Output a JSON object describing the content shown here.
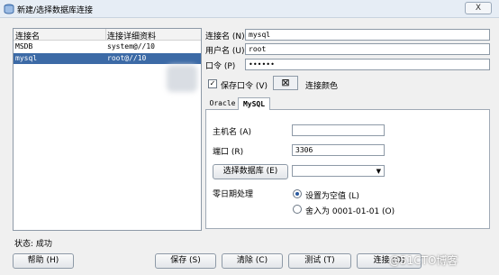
{
  "window": {
    "title": "新建/选择数据库连接",
    "close_label": "X"
  },
  "connections": {
    "headers": [
      "连接名",
      "连接详细资料"
    ],
    "rows": [
      {
        "name": "MSDB",
        "detail": "system@//10"
      },
      {
        "name": "mysql",
        "detail": "root@//10"
      }
    ],
    "selected_index": 1
  },
  "form": {
    "connection_name_label": "连接名 (N)",
    "connection_name_value": "mysql",
    "username_label": "用户名 (U)",
    "username_value": "root",
    "password_label": "口令 (P)",
    "password_value": "••••••",
    "save_password_label": "保存口令 (V)",
    "save_password_checked": true,
    "color_label": "连接颜色",
    "color_button_glyph": "⊠"
  },
  "tabs": [
    {
      "label": "Oracle",
      "active": false
    },
    {
      "label": "MySQL",
      "active": true
    }
  ],
  "mysql": {
    "host_label": "主机名 (A)",
    "host_value": "",
    "port_label": "端口 (R)",
    "port_value": "3306",
    "select_db_label": "选择数据库 (E)",
    "select_db_value": "",
    "zero_date_label": "零日期处理",
    "zero_date_options": [
      {
        "label": "设置为空值 (L)",
        "selected": true
      },
      {
        "label": "舍入为 0001-01-01 (O)",
        "selected": false
      }
    ]
  },
  "status": {
    "text": "状态: 成功"
  },
  "buttons": {
    "help": "帮助 (H)",
    "save": "保存 (S)",
    "clear": "清除 (C)",
    "test": "测试 (T)",
    "connect": "连接 (O)"
  },
  "watermark": "@51CTO博客"
}
